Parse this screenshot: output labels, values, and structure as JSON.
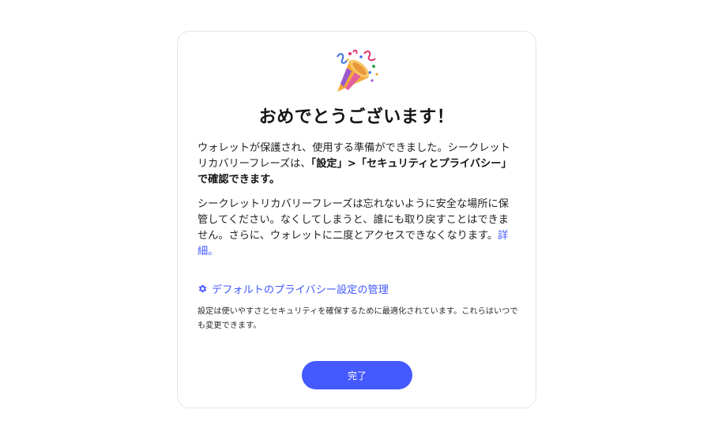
{
  "dialog": {
    "emoji_icon": "party-popper-icon",
    "title": "おめでとうございます！",
    "para1": {
      "text_before": "ウォレットが保護され、使用する準備ができました。シークレットリカバリーフレーズは、",
      "bold": "「設定」>「セキュリティとプライバシー」で確認できます。"
    },
    "para2": {
      "text": "シークレットリカバリーフレーズは忘れないように安全な場所に保管してください。なくしてしまうと、誰にも取り戻すことはできません。さらに、ウォレットに二度とアクセスできなくなります。",
      "link": "詳細。"
    },
    "settings_link": {
      "icon": "gear-icon",
      "label": "デフォルトのプライバシー設定の管理"
    },
    "note": "設定は使いやすさとセキュリティを確保するために最適化されています。これらはいつでも変更できます。",
    "done_button": "完了"
  },
  "colors": {
    "accent": "#4459ff",
    "border": "#e6e6e6",
    "text": "#222222"
  }
}
